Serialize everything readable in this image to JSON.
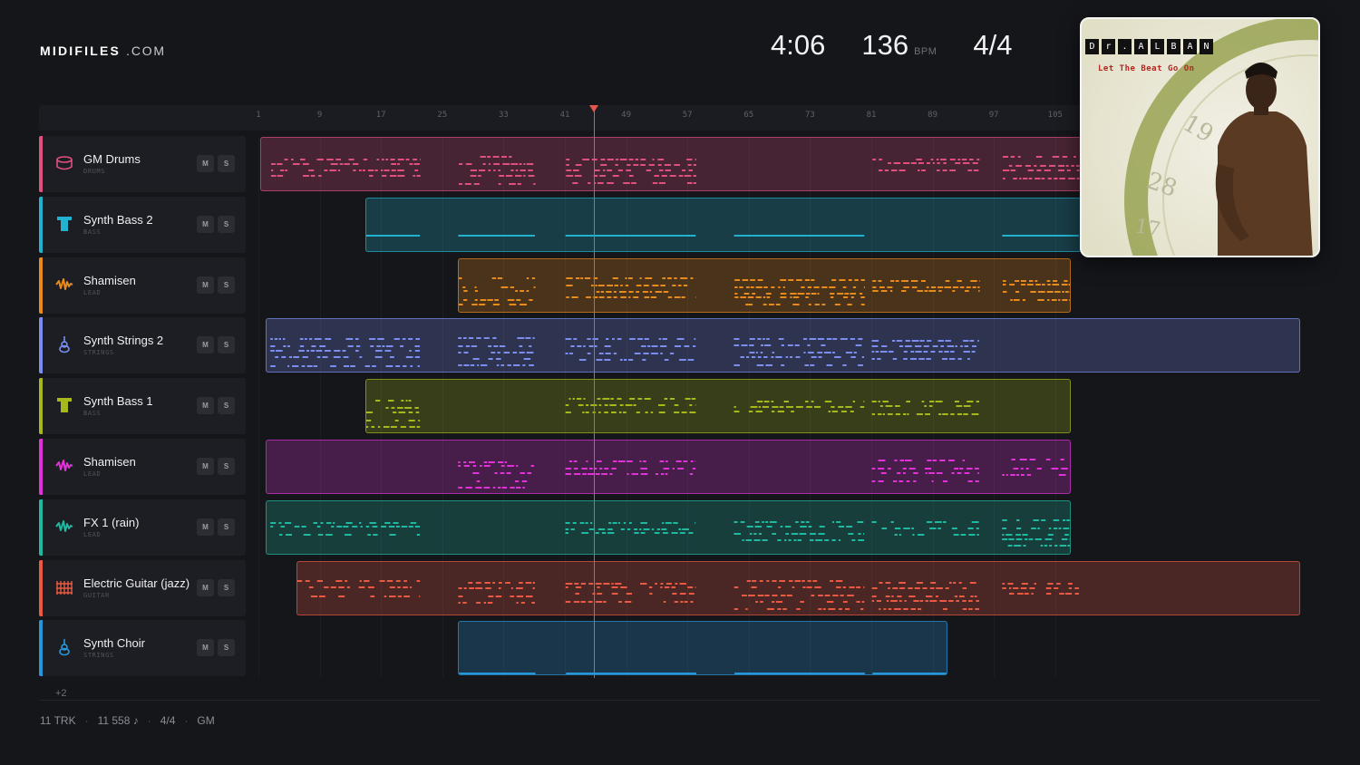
{
  "brand": {
    "name": "MIDIFILES",
    "tld": ".COM"
  },
  "stats": {
    "duration": "4:06",
    "tempo": "136",
    "tempo_unit": "BPM",
    "time_signature": "4/4"
  },
  "album": {
    "title_letters": [
      "D",
      "r",
      ".",
      "A",
      "L",
      "B",
      "A",
      "N"
    ],
    "subtitle": "Let The Beat Go On"
  },
  "ruler": {
    "ticks": [
      "1",
      "9",
      "17",
      "25",
      "33",
      "41",
      "49",
      "57",
      "65",
      "73",
      "81",
      "89",
      "97",
      "105"
    ]
  },
  "playhead_bar": 45,
  "tracks": [
    {
      "name": "GM Drums",
      "category": "DRUMS",
      "color": "#e0507e",
      "icon": "drum-icon",
      "mute": "M",
      "solo": "S"
    },
    {
      "name": "Synth Bass 2",
      "category": "BASS",
      "color": "#22b2cf",
      "icon": "bass-icon",
      "mute": "M",
      "solo": "S"
    },
    {
      "name": "Shamisen",
      "category": "LEAD",
      "color": "#e88a1c",
      "icon": "wave-icon",
      "mute": "M",
      "solo": "S"
    },
    {
      "name": "Synth Strings 2",
      "category": "STRINGS",
      "color": "#7b8ef0",
      "icon": "violin-icon",
      "mute": "M",
      "solo": "S"
    },
    {
      "name": "Synth Bass 1",
      "category": "BASS",
      "color": "#a6b81c",
      "icon": "bass-icon",
      "mute": "M",
      "solo": "S"
    },
    {
      "name": "Shamisen",
      "category": "LEAD",
      "color": "#e033d7",
      "icon": "wave-icon",
      "mute": "M",
      "solo": "S"
    },
    {
      "name": "FX 1 (rain)",
      "category": "LEAD",
      "color": "#1fb8a0",
      "icon": "wave-icon",
      "mute": "M",
      "solo": "S"
    },
    {
      "name": "Electric Guitar (jazz)",
      "category": "GUITAR",
      "color": "#ea5a43",
      "icon": "guitar-icon",
      "mute": "M",
      "solo": "S"
    },
    {
      "name": "Synth Choir",
      "category": "STRINGS",
      "color": "#2897da",
      "icon": "violin-icon",
      "mute": "M",
      "solo": "S"
    }
  ],
  "more_tracks": "+2",
  "footer": {
    "tracks": "11 TRK",
    "notes": "11 558 ♪",
    "time_signature": "4/4",
    "standard": "GM"
  }
}
